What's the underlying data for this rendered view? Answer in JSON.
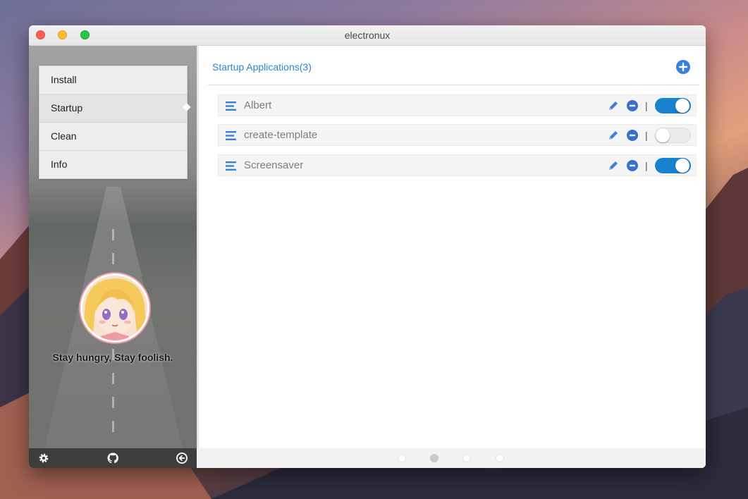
{
  "window": {
    "title": "electronux"
  },
  "sidebar": {
    "items": [
      {
        "label": "Install",
        "active": false
      },
      {
        "label": "Startup",
        "active": true
      },
      {
        "label": "Clean",
        "active": false
      },
      {
        "label": "Info",
        "active": false
      }
    ],
    "motto": "Stay hungry, Stay foolish.",
    "footer_icons": [
      "gear-icon",
      "github-icon",
      "arrow-left-circle-icon"
    ]
  },
  "main": {
    "header": "Startup Applications(3)",
    "add_icon": "plus-circle-icon",
    "rows": [
      {
        "name": "Albert",
        "enabled": true
      },
      {
        "name": "create-template",
        "enabled": false
      },
      {
        "name": "Screensaver",
        "enabled": true
      }
    ],
    "separator": "|"
  },
  "pagination": {
    "count": 4,
    "active_index": 1
  },
  "colors": {
    "accent": "#2e86d6",
    "toggle_on": "#1782d0",
    "sidebar_footer": "#3d3d3d"
  }
}
